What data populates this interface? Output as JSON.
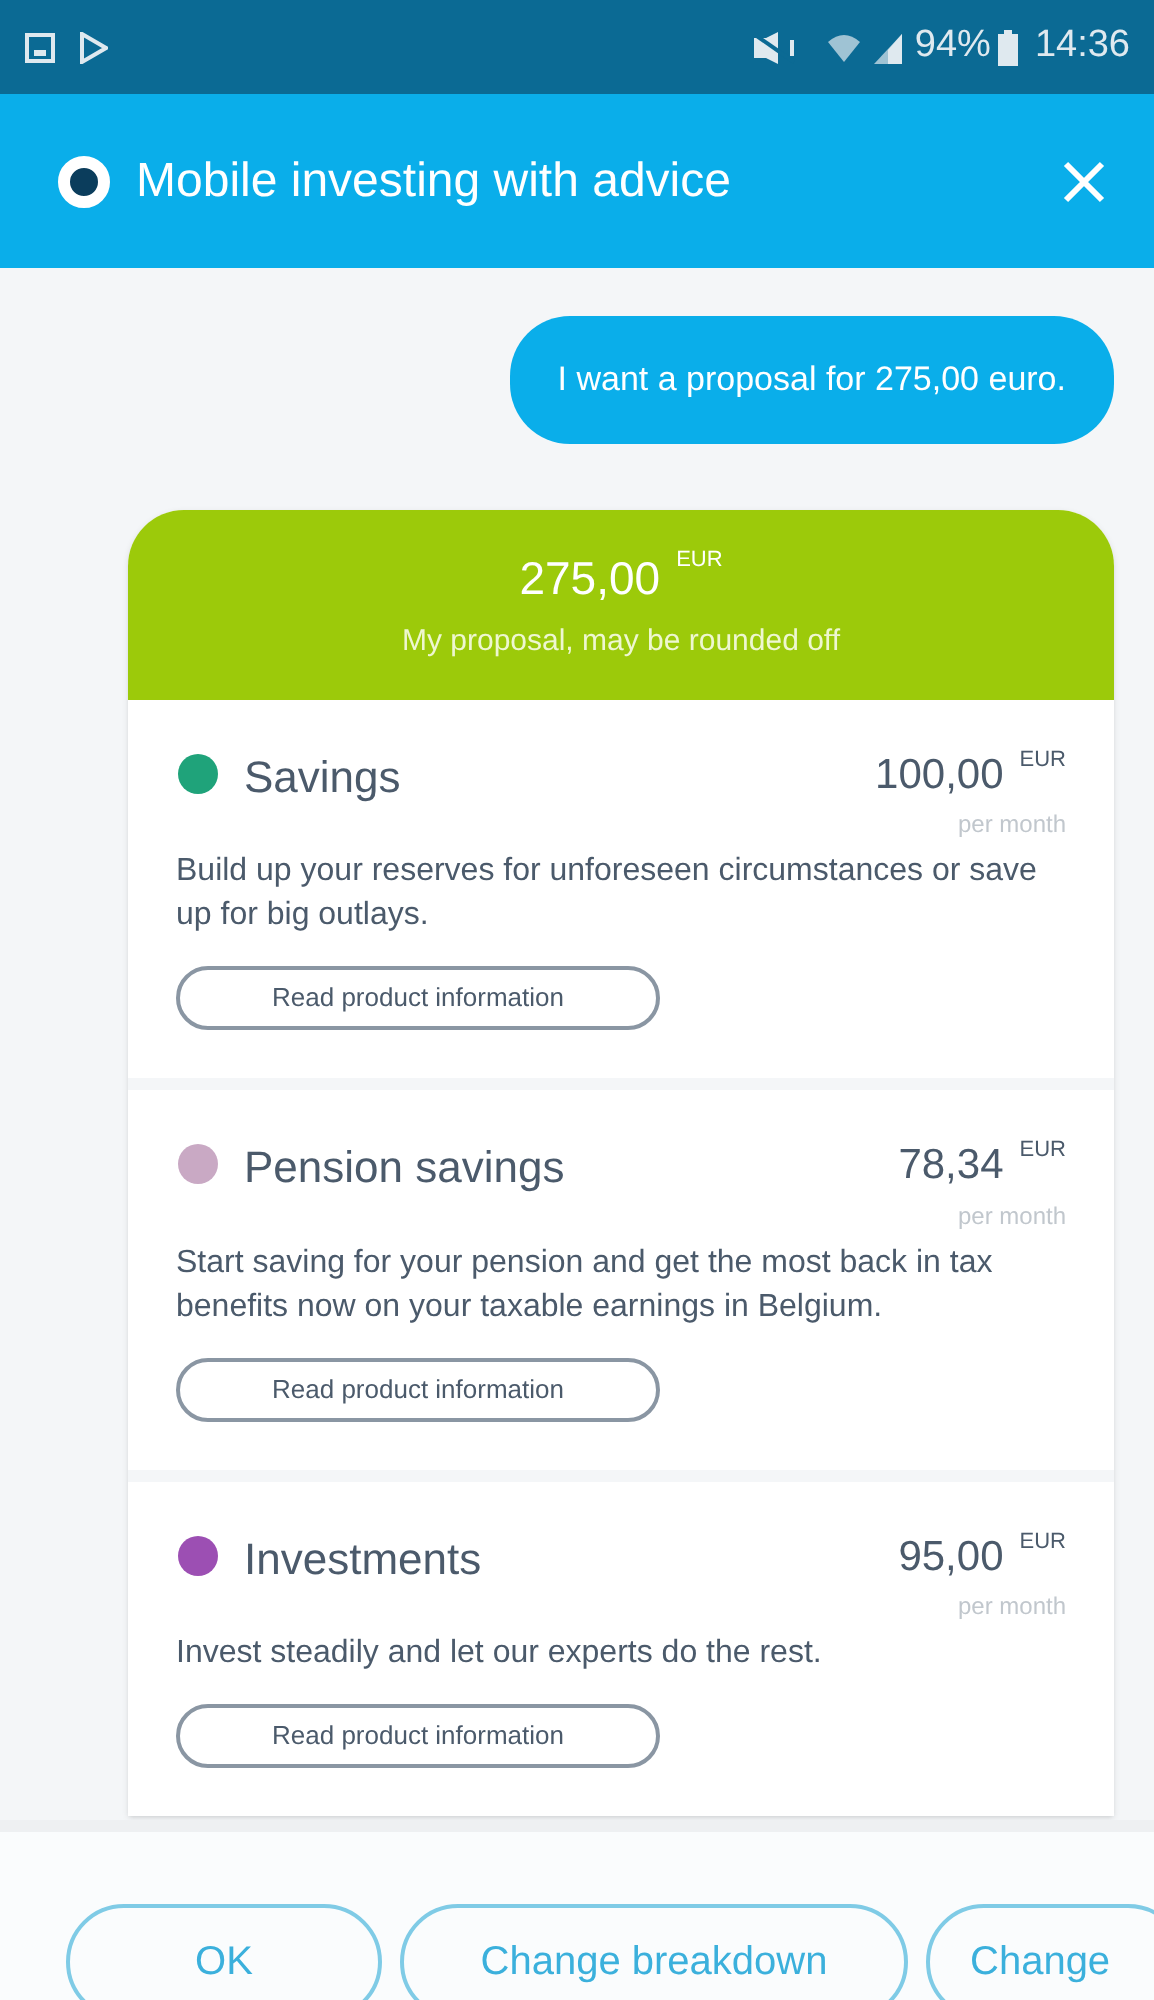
{
  "status_bar": {
    "battery": "94%",
    "time": "14:36"
  },
  "header": {
    "title": "Mobile investing with advice"
  },
  "message": {
    "text": "I want a proposal for 275,00 euro."
  },
  "proposal": {
    "amount": "275,00",
    "currency": "EUR",
    "subtitle": "My proposal, may be rounded off",
    "products": [
      {
        "name": "Savings",
        "amount": "100,00",
        "currency": "EUR",
        "period": "per month",
        "description": "Build up your reserves for unforeseen circumstances or save up for big outlays.",
        "link": "Read product information",
        "color": "#1fa37a"
      },
      {
        "name": "Pension savings",
        "amount": "78,34",
        "currency": "EUR",
        "period": "per month",
        "description": "Start saving for your pension and get the most back in tax benefits now on your taxable earnings in Belgium.",
        "link": "Read product information",
        "color": "#c9a9c4"
      },
      {
        "name": "Investments",
        "amount": "95,00",
        "currency": "EUR",
        "period": "per month",
        "description": "Invest steadily and let our experts do the rest.",
        "link": "Read product information",
        "color": "#9c4fb3"
      }
    ]
  },
  "actions": [
    "OK",
    "Change breakdown",
    "Change"
  ]
}
